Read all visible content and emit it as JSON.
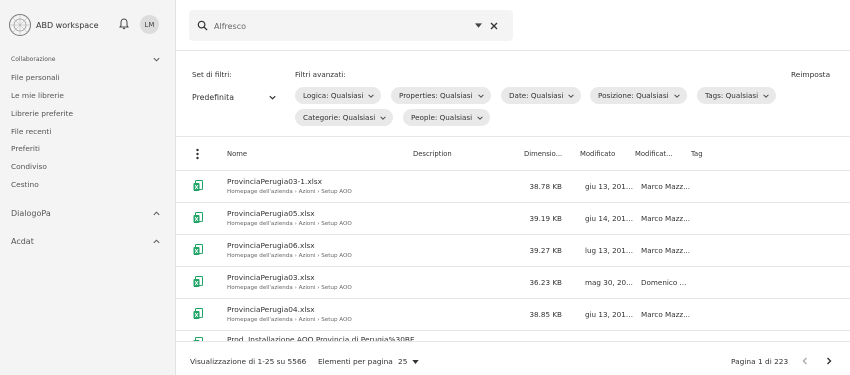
{
  "app": {
    "name": "ABD workspace",
    "avatar": "LM"
  },
  "sidebar": {
    "section_collab": "Collaborazione",
    "items": [
      "File personali",
      "Le mie librerie",
      "Librerie preferite",
      "File recenti",
      "Preferiti",
      "Condiviso",
      "Cestino"
    ],
    "section_dialogopa": "DialogoPa",
    "section_acdat": "Acdat"
  },
  "search": {
    "value": "Alfresco"
  },
  "filters": {
    "set_label": "Set di filtri:",
    "set_value": "Predefinita",
    "advanced_label": "Filtri avanzati:",
    "reset_label": "Reimposta",
    "chips": [
      "Logica: Qualsiasi",
      "Properties: Qualsiasi",
      "Date: Qualsiasi",
      "Posizione: Qualsiasi",
      "Tags: Qualsiasi",
      "Categorie: Qualsiasi",
      "People: Qualsiasi"
    ]
  },
  "table": {
    "headers": {
      "name": "Nome",
      "description": "Description",
      "size": "Dimensio...",
      "modified": "Modificato",
      "modified_by": "Modificat...",
      "tag": "Tag"
    },
    "rows": [
      {
        "name": "ProvinciaPerugia03-1.xlsx",
        "path": "Homepage dell'azienda › Azioni › Setup AOO",
        "size": "38.78 KB",
        "modified": "giu 13, 2018...",
        "by": "Marco Mazz..."
      },
      {
        "name": "ProvinciaPerugia05.xlsx",
        "path": "Homepage dell'azienda › Azioni › Setup AOO",
        "size": "39.19 KB",
        "modified": "giu 14, 2018...",
        "by": "Marco Mazz..."
      },
      {
        "name": "ProvinciaPerugia06.xlsx",
        "path": "Homepage dell'azienda › Azioni › Setup AOO",
        "size": "39.27 KB",
        "modified": "lug 13, 2018...",
        "by": "Marco Mazz..."
      },
      {
        "name": "ProvinciaPerugia03.xlsx",
        "path": "Homepage dell'azienda › Azioni › Setup AOO",
        "size": "36.23 KB",
        "modified": "mag 30, 20...",
        "by": "Domenico ..."
      },
      {
        "name": "ProvinciaPerugia04.xlsx",
        "path": "Homepage dell'azienda › Azioni › Setup AOO",
        "size": "38.85 KB",
        "modified": "giu 13, 2018...",
        "by": "Marco Mazz..."
      },
      {
        "name": "Prod. Installazione AOO Provincia di Perugia%30BE",
        "path": "",
        "size": "",
        "modified": "",
        "by": ""
      }
    ]
  },
  "footer": {
    "range": "Visualizzazione di 1-25 su 5566",
    "per_page_label": "Elementi per pagina",
    "per_page_value": "25",
    "page": "Pagina 1 di 223"
  },
  "colors": {
    "file_icon": "#21a366",
    "sidebar_bg": "#f4f4f4",
    "chip_bg": "#e9e9e9"
  }
}
